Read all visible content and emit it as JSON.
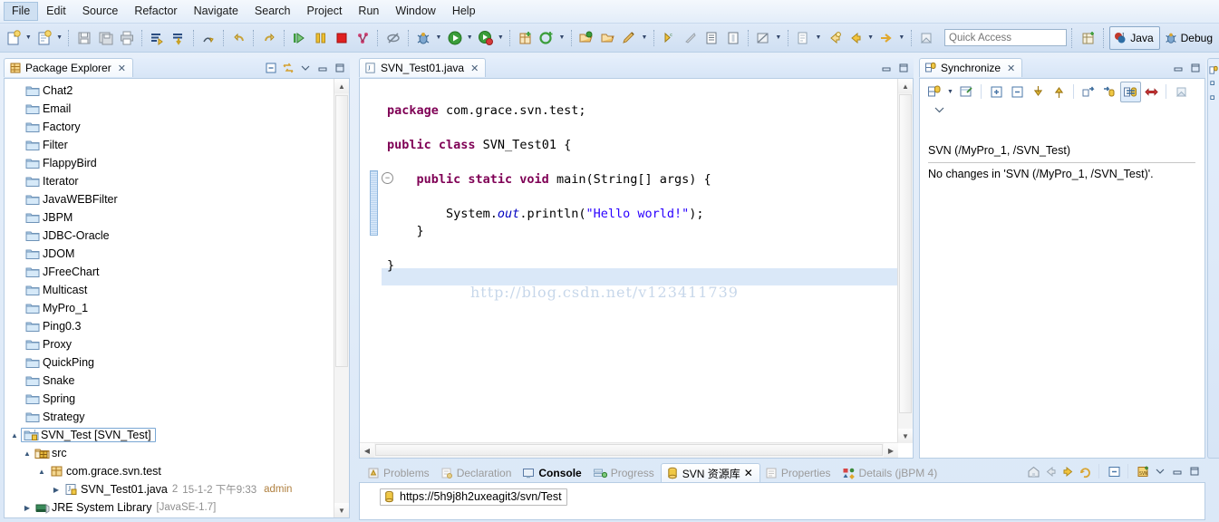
{
  "menu": {
    "items": [
      {
        "label": "File",
        "active": true
      },
      {
        "label": "Edit",
        "active": false
      },
      {
        "label": "Source",
        "active": false
      },
      {
        "label": "Refactor",
        "active": false
      },
      {
        "label": "Navigate",
        "active": false
      },
      {
        "label": "Search",
        "active": false
      },
      {
        "label": "Project",
        "active": false
      },
      {
        "label": "Run",
        "active": false
      },
      {
        "label": "Window",
        "active": false
      },
      {
        "label": "Help",
        "active": false
      }
    ]
  },
  "toolbar": {
    "quick_access_placeholder": "Quick Access",
    "perspective_java": "Java",
    "perspective_debug": "Debug",
    "icons": [
      "new-wizard-icon",
      "new-wizard-dropdown",
      "new-java-class-icon",
      "new-java-class-dropdown",
      "save-icon",
      "save-all-icon",
      "print-icon",
      "build-all-icon",
      "build-project-icon",
      "undo-icon",
      "redo-icon",
      "step-icon",
      "resume-icon",
      "suspend-icon",
      "terminate-icon",
      "disconnect-icon",
      "skip-breakpoints-icon",
      "debug-icon",
      "debug-dropdown",
      "run-icon",
      "run-dropdown",
      "run-coverage-icon",
      "run-coverage-dropdown",
      "new-java-project-icon",
      "new-annotation-icon",
      "new-class-dropdown",
      "open-type-icon",
      "open-task-icon",
      "edit-icon",
      "edit-dropdown",
      "next-annotation-icon",
      "previous-annotation-icon",
      "toggle-mark-occurrences-icon",
      "toggle-block-selection-icon",
      "toggle-whitespace-icon",
      "search-icon",
      "search-dropdown",
      "next-edit-icon",
      "next-edit-dropdown",
      "back-icon",
      "forward-icon",
      "forward-dropdown",
      "go-icon",
      "go-dropdown",
      "pin-editor-icon",
      "open-perspective-icon"
    ]
  },
  "package_explorer": {
    "tab_label": "Package Explorer",
    "tab_icon": "package-explorer-icon",
    "controls": [
      "collapse-all-icon",
      "link-with-editor-icon",
      "view-menu-icon",
      "minimize-icon",
      "maximize-icon"
    ],
    "items": [
      {
        "label": "Chat2",
        "icon": "folder-icon",
        "indent": 1,
        "twisty": "",
        "type": "project"
      },
      {
        "label": "Email",
        "icon": "folder-icon",
        "indent": 1,
        "twisty": "",
        "type": "project"
      },
      {
        "label": "Factory",
        "icon": "folder-icon",
        "indent": 1,
        "twisty": "",
        "type": "project"
      },
      {
        "label": "Filter",
        "icon": "folder-icon",
        "indent": 1,
        "twisty": "",
        "type": "project"
      },
      {
        "label": "FlappyBird",
        "icon": "folder-icon",
        "indent": 1,
        "twisty": "",
        "type": "project"
      },
      {
        "label": "Iterator",
        "icon": "folder-icon",
        "indent": 1,
        "twisty": "",
        "type": "project"
      },
      {
        "label": "JavaWEBFilter",
        "icon": "folder-icon",
        "indent": 1,
        "twisty": "",
        "type": "project"
      },
      {
        "label": "JBPM",
        "icon": "folder-icon",
        "indent": 1,
        "twisty": "",
        "type": "project"
      },
      {
        "label": "JDBC-Oracle",
        "icon": "folder-icon",
        "indent": 1,
        "twisty": "",
        "type": "project"
      },
      {
        "label": "JDOM",
        "icon": "folder-icon",
        "indent": 1,
        "twisty": "",
        "type": "project"
      },
      {
        "label": "JFreeChart",
        "icon": "folder-icon",
        "indent": 1,
        "twisty": "",
        "type": "project"
      },
      {
        "label": "Multicast",
        "icon": "folder-icon",
        "indent": 1,
        "twisty": "",
        "type": "project"
      },
      {
        "label": "MyPro_1",
        "icon": "folder-icon",
        "indent": 1,
        "twisty": "",
        "type": "project"
      },
      {
        "label": "Ping0.3",
        "icon": "folder-icon",
        "indent": 1,
        "twisty": "",
        "type": "project"
      },
      {
        "label": "Proxy",
        "icon": "folder-icon",
        "indent": 1,
        "twisty": "",
        "type": "project"
      },
      {
        "label": "QuickPing",
        "icon": "folder-icon",
        "indent": 1,
        "twisty": "",
        "type": "project"
      },
      {
        "label": "Snake",
        "icon": "folder-icon",
        "indent": 1,
        "twisty": "",
        "type": "project"
      },
      {
        "label": "Spring",
        "icon": "folder-icon",
        "indent": 1,
        "twisty": "",
        "type": "project"
      },
      {
        "label": "Strategy",
        "icon": "folder-icon",
        "indent": 1,
        "twisty": "",
        "type": "project"
      }
    ],
    "selected_project": {
      "label": "SVN_Test [SVN_Test]",
      "icon": "svn-project-icon",
      "twisty": "expanded"
    },
    "src_node": {
      "label": "src",
      "icon": "source-folder-icon",
      "twisty": "expanded"
    },
    "package_node": {
      "label": "com.grace.svn.test",
      "icon": "package-icon",
      "twisty": "expanded"
    },
    "file_node": {
      "label": "SVN_Test01.java",
      "icon": "java-file-icon",
      "twisty": "collapsed",
      "revision": "2",
      "date": "15-1-2 下午9:33",
      "author": "admin"
    },
    "jre_node": {
      "label": "JRE System Library",
      "suffix": "[JavaSE-1.7]",
      "icon": "library-icon",
      "twisty": "collapsed"
    }
  },
  "editor": {
    "tab_label": "SVN_Test01.java",
    "tab_icon": "java-file-icon",
    "controls": [
      "minimize-icon",
      "maximize-icon"
    ],
    "watermark": "http://blog.csdn.net/v123411739",
    "code_lines": [
      [
        {
          "t": "package",
          "c": "kw"
        },
        {
          "t": " com.grace.svn.test;",
          "c": ""
        }
      ],
      [],
      [
        {
          "t": "public class",
          "c": "kw"
        },
        {
          "t": " SVN_Test01 {",
          "c": ""
        }
      ],
      [],
      [
        {
          "t": "    public static void",
          "c": "kw"
        },
        {
          "t": " main(String[] args) {",
          "c": ""
        }
      ],
      [],
      [
        {
          "t": "        System.",
          "c": ""
        },
        {
          "t": "out",
          "c": "fld"
        },
        {
          "t": ".println(",
          "c": ""
        },
        {
          "t": "\"Hello world!\"",
          "c": "str"
        },
        {
          "t": ");",
          "c": ""
        }
      ],
      [
        {
          "t": "    }",
          "c": ""
        }
      ],
      [],
      [
        {
          "t": "}",
          "c": ""
        }
      ]
    ]
  },
  "synchronize": {
    "tab_label": "Synchronize",
    "tab_icon": "synchronize-icon",
    "controls": [
      "minimize-icon",
      "maximize-icon"
    ],
    "toolbar_icons": [
      "synchronize-icon",
      "synchronize-dropdown",
      "open-in-compare-icon",
      "expand-all-icon",
      "collapse-all-icon",
      "update-icon",
      "commit-icon",
      "outgoing-mode-icon",
      "incoming-mode-icon",
      "both-mode-icon",
      "conflicts-mode-icon",
      "pin-icon",
      "view-menu-icon"
    ],
    "title": "SVN (/MyPro_1, /SVN_Test)",
    "message": "No changes in 'SVN (/MyPro_1, /SVN_Test)'."
  },
  "bottom_panel": {
    "tabs": [
      {
        "label": "Problems",
        "icon": "problems-icon",
        "state": "inactive"
      },
      {
        "label": "Declaration",
        "icon": "declaration-icon",
        "state": "inactive"
      },
      {
        "label": "Console",
        "icon": "console-icon",
        "state": "bold"
      },
      {
        "label": "Progress",
        "icon": "progress-icon",
        "state": "inactive"
      },
      {
        "label": "SVN 资源库",
        "icon": "svn-repository-icon",
        "state": "selected"
      },
      {
        "label": "Properties",
        "icon": "properties-icon",
        "state": "inactive"
      },
      {
        "label": "Details (jBPM 4)",
        "icon": "details-icon",
        "state": "inactive"
      }
    ],
    "controls": [
      "home-icon",
      "back-icon",
      "forward-icon",
      "refresh-icon",
      "collapse-all-icon",
      "new-repository-icon",
      "view-menu-icon",
      "minimize-icon",
      "maximize-icon"
    ],
    "repository_url": "https://5h9j8h2uxeagit3/svn/Test",
    "repository_icon": "svn-repository-location-icon"
  },
  "right_rail": {
    "icons": [
      "synchronize-icon",
      "outline-icon",
      "task-list-icon"
    ]
  },
  "colors": {
    "keyword": "#7f0055",
    "string": "#2a00ff",
    "field": "#0000c0",
    "chrome": "#d4e3f5",
    "selection": "#dae8f8",
    "watermark": "#c7d7ea"
  }
}
